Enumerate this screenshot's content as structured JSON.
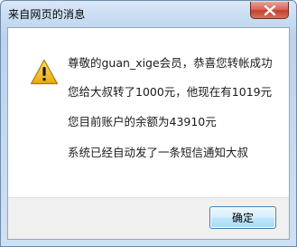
{
  "window": {
    "title": "来自网页的消息"
  },
  "icons": {
    "title_close": "close-icon",
    "message": "warning-icon"
  },
  "message": {
    "line1": "尊敬的guan_xige会员，恭喜您转帐成功",
    "line2": "您给大叔转了1000元，他现在有1019元",
    "line3": "您目前账户的余额为43910元",
    "line4": "系统已经自动发了一条短信通知大叔"
  },
  "buttons": {
    "ok_label": "确定"
  },
  "colors": {
    "warning_fill": "#f5c518",
    "close_button": "#c4402f",
    "frame": "#c7dbf1"
  }
}
